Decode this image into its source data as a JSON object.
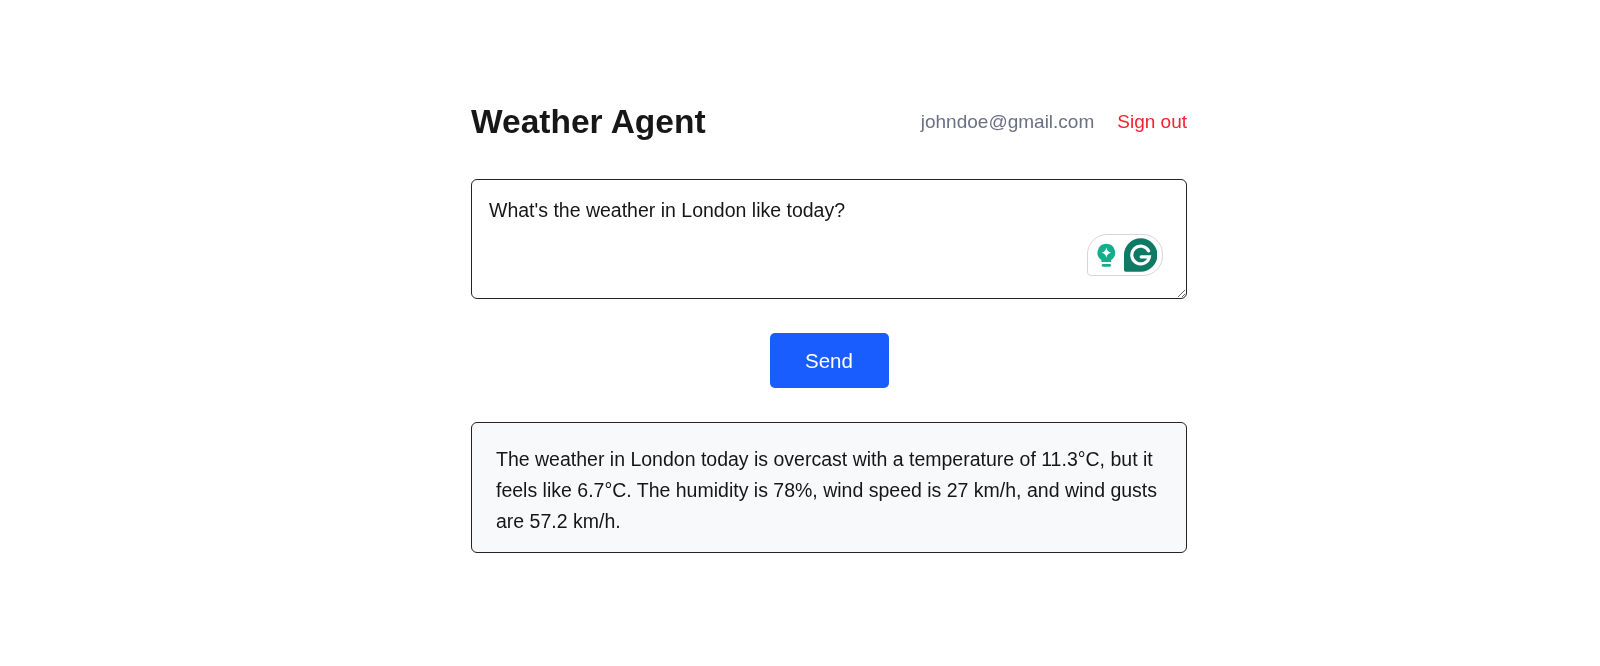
{
  "header": {
    "title": "Weather Agent",
    "user_email": "johndoe@gmail.com",
    "sign_out": "Sign out"
  },
  "prompt": {
    "value": "What's the weather in London like today?"
  },
  "send_button": {
    "label": "Send"
  },
  "response": {
    "text": "The weather in London today is overcast with a temperature of 11.3°C, but it feels like 6.7°C. The humidity is 78%, wind speed is 27 km/h, and wind gusts are 57.2 km/h."
  }
}
